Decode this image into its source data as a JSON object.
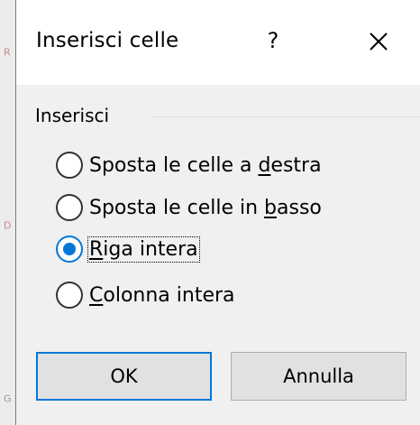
{
  "sheet": {
    "row_labels": [
      "R",
      "D",
      "G"
    ]
  },
  "dialog": {
    "title": "Inserisci celle",
    "help": "?",
    "close_icon": "close-icon",
    "group_label": "Inserisci",
    "options": [
      {
        "pre": "Sposta le celle a ",
        "key": "d",
        "post": "estra",
        "checked": false
      },
      {
        "pre": "Sposta le celle in ",
        "key": "b",
        "post": "asso",
        "checked": false
      },
      {
        "pre": "",
        "key": "R",
        "post": "iga intera",
        "checked": true
      },
      {
        "pre": "",
        "key": "C",
        "post": "olonna intera",
        "checked": false
      }
    ],
    "ok_label": "OK",
    "cancel_label": "Annulla",
    "accent_color": "#0078d7"
  }
}
